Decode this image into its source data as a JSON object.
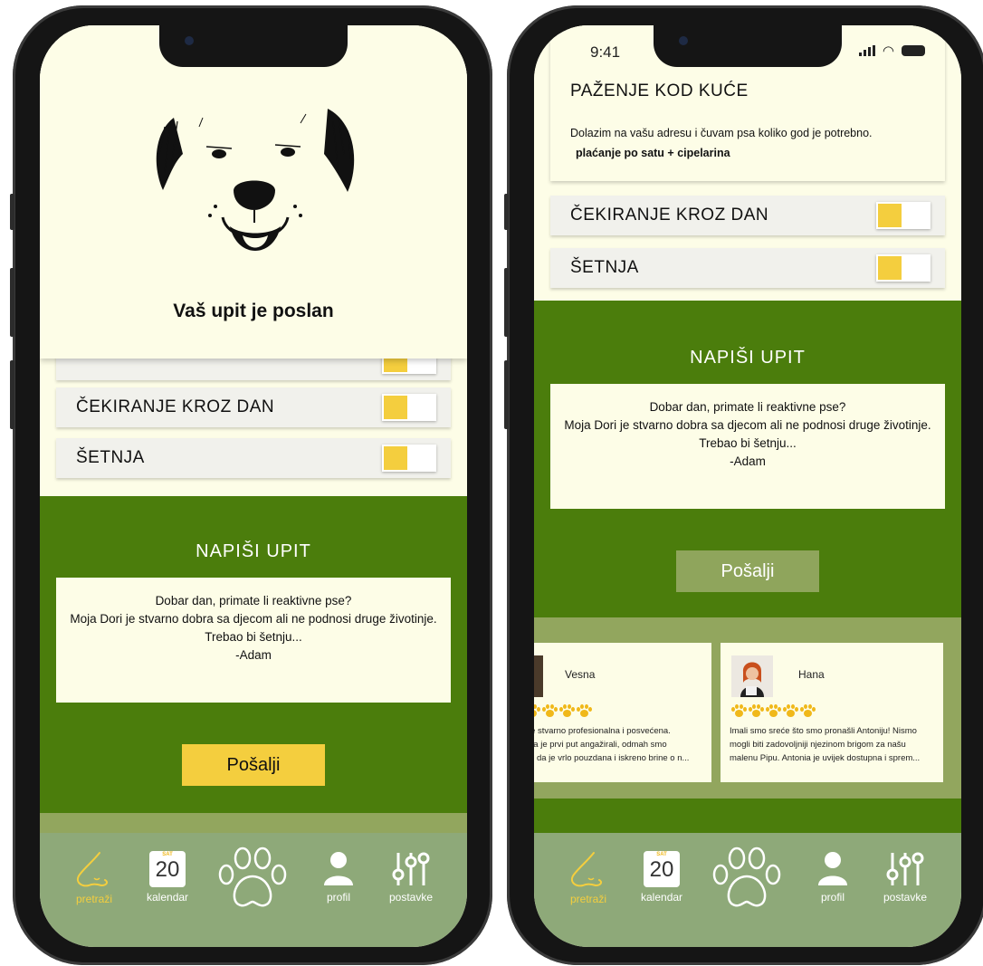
{
  "status": {
    "time": "9:41"
  },
  "colors": {
    "cream": "#fdfde7",
    "green": "#4b7d0c",
    "olive": "#92a65e",
    "nav": "#8ea979",
    "yellow": "#f4ce3e",
    "button_muted": "#8fa55c"
  },
  "left": {
    "overlay_title": "Vaš upit je poslan",
    "services": [
      {
        "label": "ČEKIRANJE KROZ DAN"
      },
      {
        "label": "ŠETNJA"
      }
    ],
    "inquiry": {
      "heading": "NAPIŠI UPIT",
      "message_lines": [
        "Dobar dan, primate li reaktivne pse?",
        "Moja Dori je stvarno dobra sa djecom ali ne podnosi druge životinje.",
        "Trebao bi šetnju...",
        "-Adam"
      ],
      "send_label": "Pošalji"
    }
  },
  "right": {
    "pazenje": {
      "title": "PAŽENJE KOD KUĆE",
      "description": "Dolazim na vašu adresu i čuvam psa koliko god je potrebno.",
      "pricing": "plaćanje po satu + cipelarina"
    },
    "services": [
      {
        "label": "ČEKIRANJE KROZ DAN"
      },
      {
        "label": "ŠETNJA"
      }
    ],
    "inquiry": {
      "heading": "NAPIŠI UPIT",
      "message_lines": [
        "Dobar dan, primate li reaktivne pse?",
        "Moja Dori je stvarno dobra sa djecom ali ne podnosi druge životinje.",
        "Trebao bi šetnju...",
        "-Adam"
      ],
      "send_label": "Pošalji"
    },
    "reviews": [
      {
        "name": "Vesna",
        "rating": 5,
        "lines": [
          "je stvarno profesionalna i posvećena.",
          "na je prvi put angažirali, odmah smo",
          "ili da je vrlo pouzdana i iskreno brine o n..."
        ]
      },
      {
        "name": "Hana",
        "rating": 5,
        "lines": [
          "Imali smo sreće što smo pronašli Antoniju! Nismo",
          "mogli biti zadovoljniji njezinom brigom za našu",
          "malenu Pipu. Antonia je uvijek dostupna i sprem..."
        ]
      }
    ]
  },
  "nav": {
    "items": [
      {
        "label": "pretraži",
        "icon": "nose-icon",
        "active": true
      },
      {
        "label": "kalendar",
        "icon": "calendar-icon",
        "active": false
      },
      {
        "label": "",
        "icon": "paw-icon",
        "active": false
      },
      {
        "label": "profil",
        "icon": "profile-icon",
        "active": false
      },
      {
        "label": "postavke",
        "icon": "sliders-icon",
        "active": false
      }
    ],
    "calendar_badge": {
      "weekday": "SAT",
      "day": "20"
    }
  }
}
